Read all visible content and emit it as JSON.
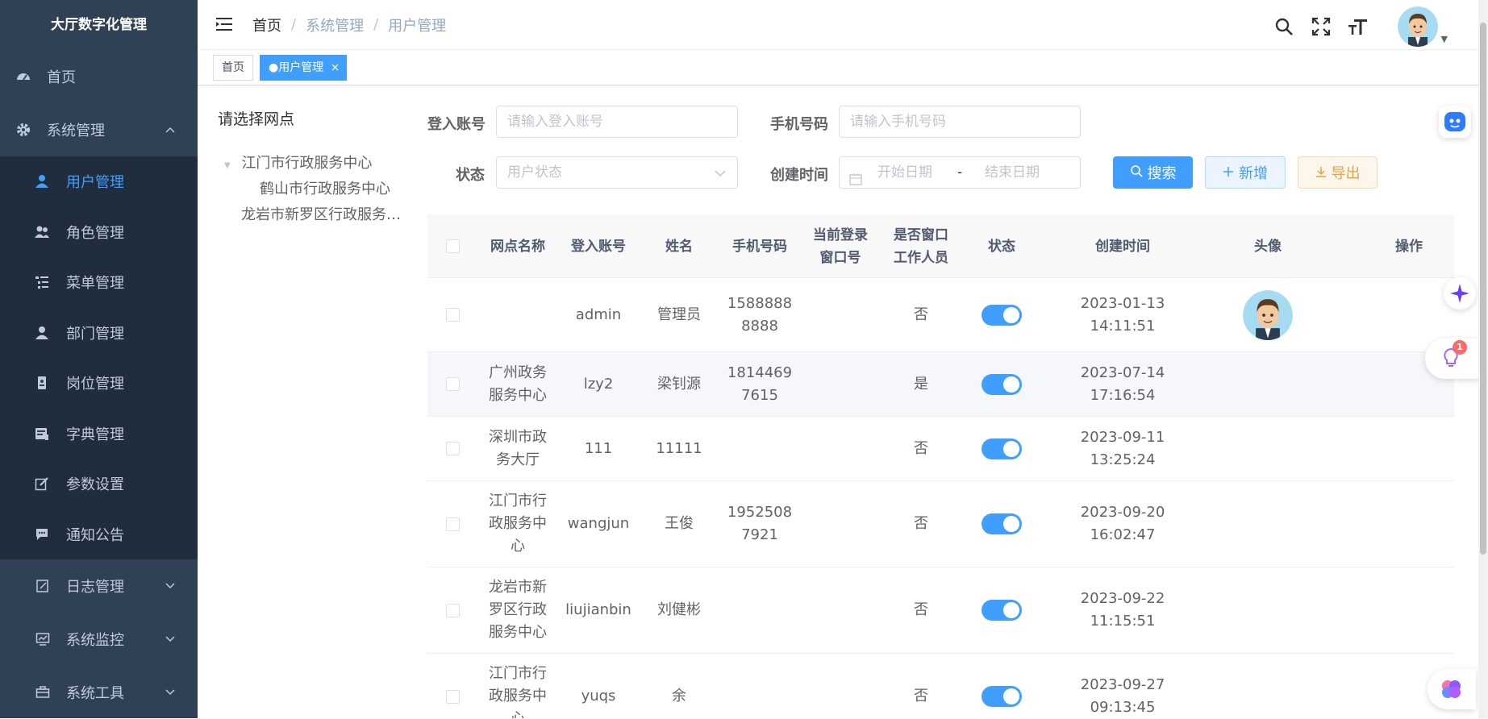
{
  "app": {
    "title": "大厅数字化管理"
  },
  "sidebar": {
    "home": "首页",
    "system": "系统管理",
    "sub_items": [
      {
        "label": "用户管理",
        "icon": "user-icon",
        "active": true
      },
      {
        "label": "角色管理",
        "icon": "peoples-icon"
      },
      {
        "label": "菜单管理",
        "icon": "tree-table-icon"
      },
      {
        "label": "部门管理",
        "icon": "tree-icon"
      },
      {
        "label": "岗位管理",
        "icon": "post-icon"
      },
      {
        "label": "字典管理",
        "icon": "dict-icon"
      },
      {
        "label": "参数设置",
        "icon": "edit-icon"
      },
      {
        "label": "通知公告",
        "icon": "message-icon"
      }
    ],
    "log": "日志管理",
    "monitor": "系统监控",
    "tool": "系统工具"
  },
  "breadcrumb": {
    "home": "首页",
    "sep": "/",
    "level1": "系统管理",
    "level2": "用户管理"
  },
  "tags": {
    "home": "首页",
    "current": "●用户管理",
    "close": "×"
  },
  "tree": {
    "title": "请选择网点",
    "nodes": [
      "江门市行政服务中心",
      "鹤山市行政服务中心",
      "龙岩市新罗区行政服务…"
    ]
  },
  "search": {
    "account_label": "登入账号",
    "account_placeholder": "请输入登入账号",
    "phone_label": "手机号码",
    "phone_placeholder": "请输入手机号码",
    "status_label": "状态",
    "status_placeholder": "用户状态",
    "date_label": "创建时间",
    "date_start": "开始日期",
    "date_sep": "-",
    "date_end": "结束日期",
    "btn_search": "搜索",
    "btn_add": "新增",
    "btn_export": "导出"
  },
  "table": {
    "headers": {
      "site": "网点名称",
      "account": "登入账号",
      "name": "姓名",
      "phone": "手机号码",
      "window_l1": "当前登录",
      "window_l2": "窗口号",
      "worker_l1": "是否窗口",
      "worker_l2": "工作人员",
      "status": "状态",
      "created": "创建时间",
      "avatar": "头像",
      "ops": "操作"
    },
    "rows": [
      {
        "site": "",
        "account": "admin",
        "name": "管理员",
        "phone_l1": "1588888",
        "phone_l2": "8888",
        "window": "",
        "worker": "否",
        "status_on": true,
        "created": "2023-01-13 14:11:51"
      },
      {
        "site": "广州政务服务中心",
        "account": "lzy2",
        "name": "梁钊源",
        "phone_l1": "1814469",
        "phone_l2": "7615",
        "window": "",
        "worker": "是",
        "status_on": true,
        "created": "2023-07-14 17:16:54"
      },
      {
        "site": "深圳市政务大厅",
        "account": "111",
        "name": "11111",
        "phone_l1": "",
        "phone_l2": "",
        "window": "",
        "worker": "否",
        "status_on": true,
        "created": "2023-09-11 13:25:24"
      },
      {
        "site": "江门市行政服务中心",
        "account": "wangjun",
        "name": "王俊",
        "phone_l1": "1952508",
        "phone_l2": "7921",
        "window": "",
        "worker": "否",
        "status_on": true,
        "created": "2023-09-20 16:02:47"
      },
      {
        "site": "龙岩市新罗区行政服务中心",
        "account": "liujianbin",
        "name": "刘健彬",
        "phone_l1": "",
        "phone_l2": "",
        "window": "",
        "worker": "否",
        "status_on": true,
        "created": "2023-09-22 11:15:51"
      },
      {
        "site": "江门市行政服务中心",
        "account": "yuqs",
        "name": "余",
        "phone_l1": "",
        "phone_l2": "",
        "window": "",
        "worker": "否",
        "status_on": true,
        "created": "2023-09-27 09:13:45"
      }
    ]
  },
  "floating": {
    "badge": "1"
  },
  "colors": {
    "sidebar_bg": "#304156",
    "submenu_bg": "#1f2d3d",
    "primary": "#409eff",
    "warning": "#e6a23c"
  }
}
